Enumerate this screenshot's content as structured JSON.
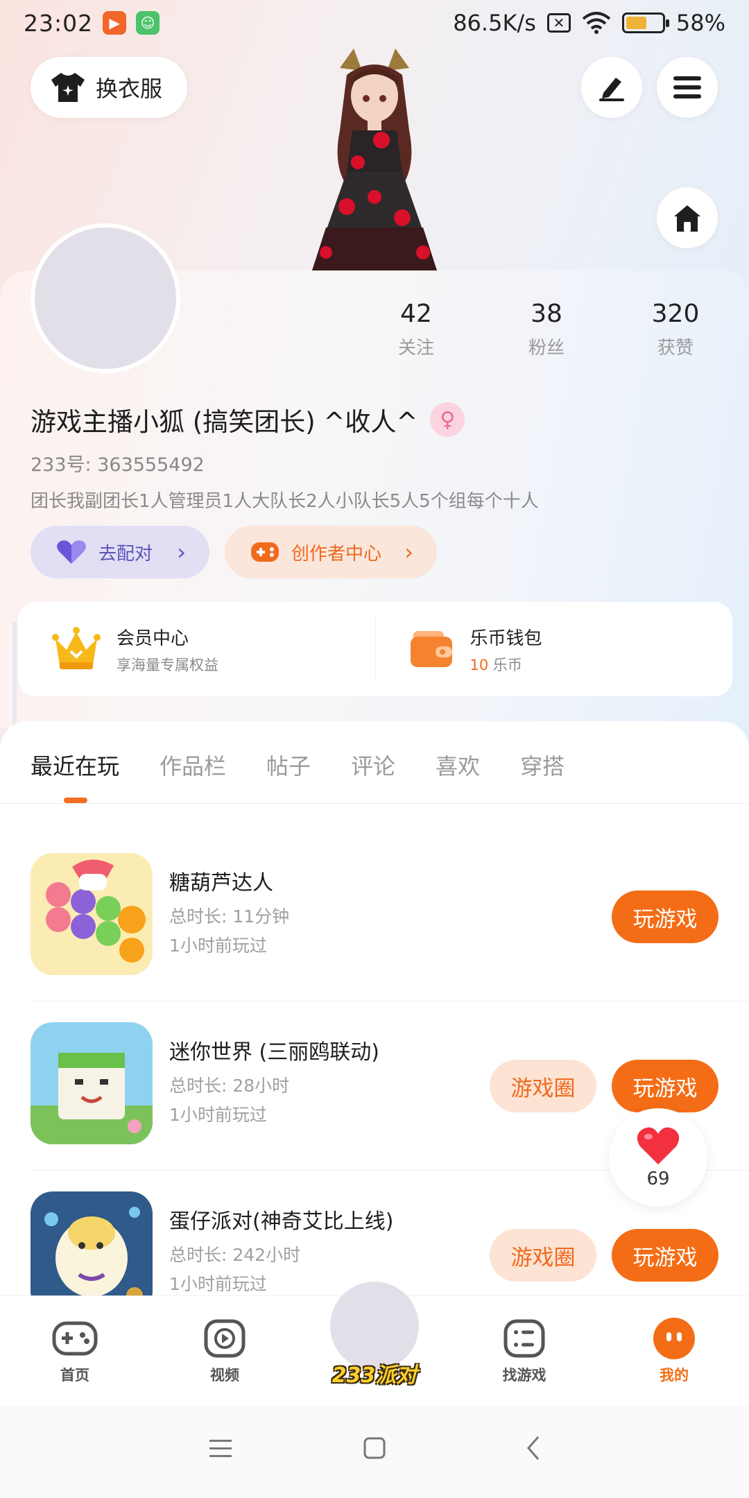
{
  "status_bar": {
    "time": "23:02",
    "net_speed": "86.5K/s",
    "battery_pct": "58%",
    "battery_level": 0.58
  },
  "top": {
    "dress_label": "换衣服"
  },
  "profile": {
    "stats": [
      {
        "value": "42",
        "label": "关注"
      },
      {
        "value": "38",
        "label": "粉丝"
      },
      {
        "value": "320",
        "label": "获赞"
      }
    ],
    "nickname": "游戏主播小狐 (搞笑团长) ^收人^",
    "uid": "233号: 363555492",
    "bio": "团长我副团长1人管理员1人大队长2人小队长5人5个组每个十人",
    "pair_label": "去配对",
    "creator_label": "创作者中心"
  },
  "vip": {
    "title": "会员中心",
    "subtitle": "享海量专属权益"
  },
  "wallet": {
    "title": "乐币钱包",
    "amount": "10",
    "unit": "乐币"
  },
  "tabs": [
    "最近在玩",
    "作品栏",
    "帖子",
    "评论",
    "喜欢",
    "穿搭"
  ],
  "games": [
    {
      "title": "糖葫芦达人",
      "time": "总时长: 11分钟",
      "last": "1小时前玩过",
      "play": "玩游戏"
    },
    {
      "title": "迷你世界 (三丽鸥联动)",
      "time": "总时长: 28小时",
      "last": "1小时前玩过",
      "circle": "游戏圈",
      "play": "玩游戏"
    },
    {
      "title": "蛋仔派对(神奇艾比上线)",
      "time": "总时长: 242小时",
      "last": "1小时前玩过",
      "circle": "游戏圈",
      "play": "玩游戏"
    }
  ],
  "like_float": {
    "count": "69"
  },
  "bottom_nav": {
    "home": "首页",
    "video": "视频",
    "party": "233派对",
    "find": "找游戏",
    "mine": "我的"
  },
  "colors": {
    "accent": "#f46d16",
    "purple": "#5b55b8"
  }
}
